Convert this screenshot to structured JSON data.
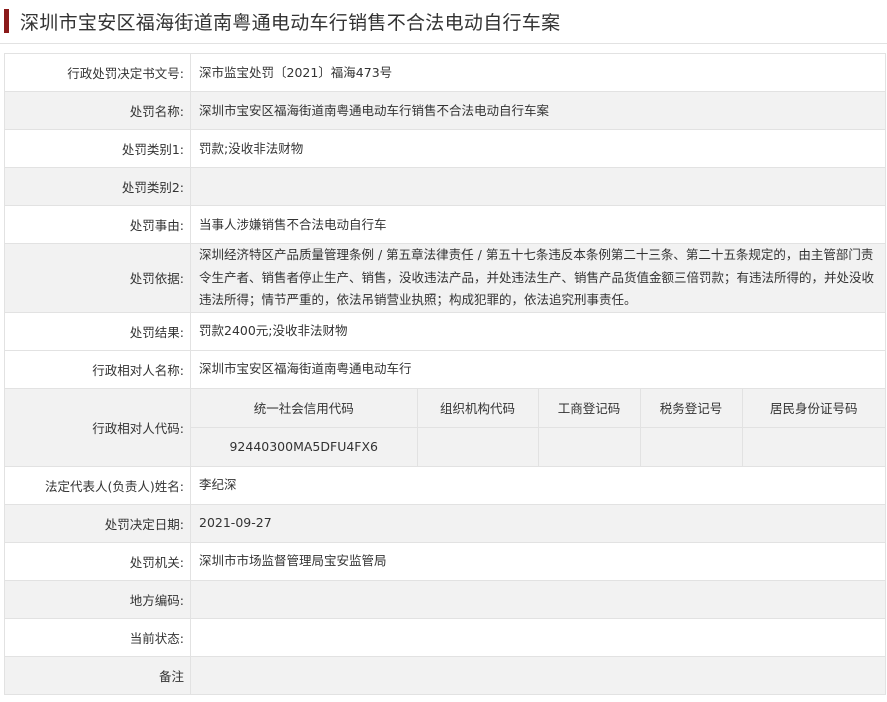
{
  "page": {
    "title": "深圳市宝安区福海街道南粤通电动车行销售不合法电动自行车案"
  },
  "rows": {
    "decision_no": {
      "label": "行政处罚决定书文号:",
      "value": "深市监宝处罚〔2021〕福海473号"
    },
    "penalty_name": {
      "label": "处罚名称:",
      "value": "深圳市宝安区福海街道南粤通电动车行销售不合法电动自行车案"
    },
    "category1": {
      "label": "处罚类别1:",
      "value": "罚款;没收非法财物"
    },
    "category2": {
      "label": "处罚类别2:",
      "value": ""
    },
    "cause": {
      "label": "处罚事由:",
      "value": "当事人涉嫌销售不合法电动自行车"
    },
    "basis": {
      "label": "处罚依据:",
      "value": "深圳经济特区产品质量管理条例 / 第五章法律责任 / 第五十七条违反本条例第二十三条、第二十五条规定的，由主管部门责令生产者、销售者停止生产、销售，没收违法产品，并处违法生产、销售产品货值金额三倍罚款；有违法所得的，并处没收违法所得；情节严重的，依法吊销营业执照；构成犯罪的，依法追究刑事责任。"
    },
    "result": {
      "label": "处罚结果:",
      "value": "罚款2400元;没收非法财物"
    },
    "party_name": {
      "label": "行政相对人名称:",
      "value": "深圳市宝安区福海街道南粤通电动车行"
    },
    "party_code": {
      "label": "行政相对人代码:",
      "headers": [
        "统一社会信用代码",
        "组织机构代码",
        "工商登记码",
        "税务登记号",
        "居民身份证号码"
      ],
      "values": [
        "92440300MA5DFU4FX6",
        "",
        "",
        "",
        ""
      ]
    },
    "legal_rep": {
      "label": "法定代表人(负责人)姓名:",
      "value": "李纪深"
    },
    "decision_date": {
      "label": "处罚决定日期:",
      "value": "2021-09-27"
    },
    "authority": {
      "label": "处罚机关:",
      "value": "深圳市市场监督管理局宝安监管局"
    },
    "local_code": {
      "label": "地方编码:",
      "value": ""
    },
    "status": {
      "label": "当前状态:",
      "value": ""
    },
    "remark": {
      "label": "备注",
      "value": ""
    }
  },
  "colors": {
    "accent": "#8b1a1a",
    "border": "#e2e2e2",
    "stripe": "#f2f2f2",
    "text": "#333333"
  }
}
